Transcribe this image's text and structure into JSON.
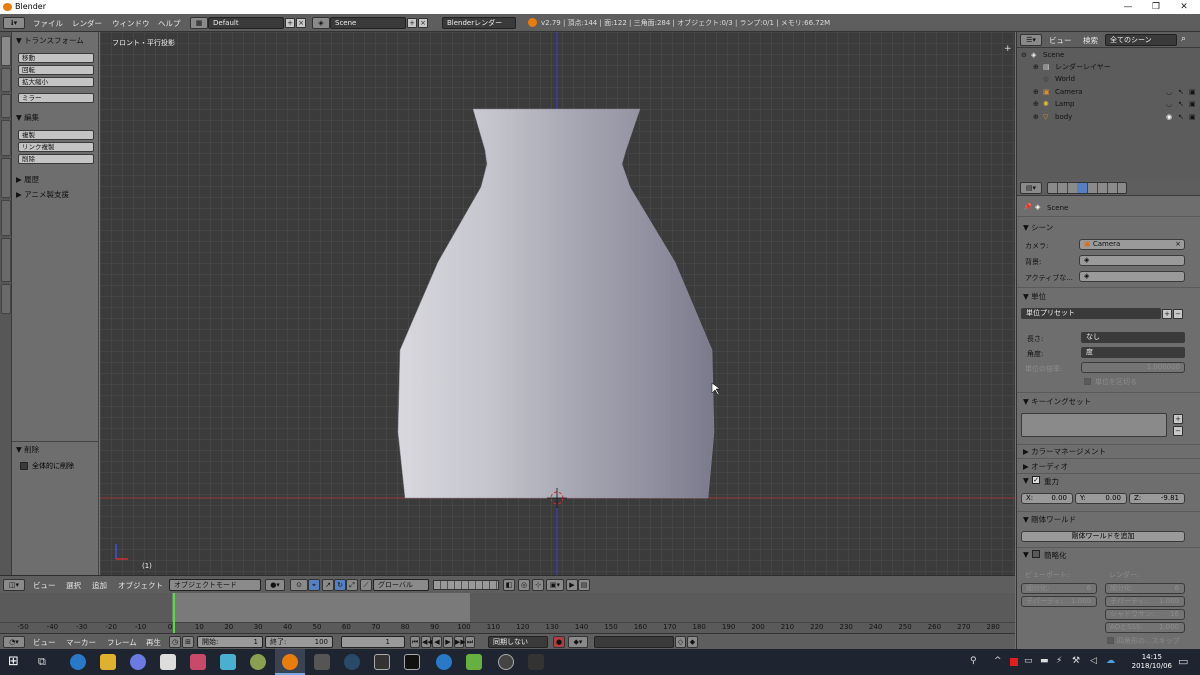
{
  "titlebar": {
    "title": "Blender",
    "minimize": "—",
    "maximize": "❐",
    "close": "✕"
  },
  "info": {
    "menus": [
      "ファイル",
      "レンダー",
      "ウィンドウ",
      "ヘルプ"
    ],
    "layout": "Default",
    "scene": "Scene",
    "engine": "Blenderレンダー",
    "stats": "v2.79 | 頂点:144 | 面:122 | 三角面:284 | オブジェクト:0/3 | ランプ:0/1 | メモリ:66.72M"
  },
  "toolshelf": {
    "transform": "▼ トランスフォーム",
    "t_buttons": [
      "移動",
      "回転",
      "拡大縮小"
    ],
    "mirror": "ミラー",
    "edit": "▼ 編集",
    "e_buttons": [
      "複製",
      "リンク複製",
      "削除"
    ],
    "history": "▶ 履歴",
    "anim": "▶ アニメ製支援",
    "op_title": "▼ 削除",
    "op_check": "全体的に削除"
  },
  "viewport": {
    "title": "フロント・平行投影",
    "frame": "(1)"
  },
  "header3d": {
    "menus": [
      "ビュー",
      "選択",
      "追加",
      "オブジェクト"
    ],
    "mode": "オブジェクトモード",
    "orientation": "グローバル"
  },
  "timeline": {
    "ticks": [
      "-50",
      "-40",
      "-30",
      "-20",
      "-10",
      "0",
      "10",
      "20",
      "30",
      "40",
      "50",
      "60",
      "70",
      "80",
      "90",
      "100",
      "110",
      "120",
      "130",
      "140",
      "150",
      "160",
      "170",
      "180",
      "190",
      "200",
      "210",
      "220",
      "230",
      "240",
      "250",
      "260",
      "270",
      "280"
    ],
    "menus": [
      "ビュー",
      "マーカー",
      "フレーム",
      "再生"
    ],
    "start": "開始:",
    "start_val": "1",
    "end": "終了:",
    "end_val": "100",
    "current": "1",
    "sync": "同期しない"
  },
  "outliner": {
    "view": "ビュー",
    "search": "検索",
    "scope": "全てのシーン",
    "rows": [
      "Scene",
      "レンダーレイヤー",
      "World",
      "Camera",
      "Lamp",
      "body"
    ]
  },
  "properties": {
    "context": "Scene",
    "scene_sect": "▼ シーン",
    "camera_lbl": "カメラ:",
    "camera_val": "Camera",
    "bg_lbl": "背景:",
    "active_lbl": "アクティブな...",
    "units_sect": "▼ 単位",
    "unit_preset": "単位プリセット",
    "length_lbl": "長さ:",
    "length_val": "なし",
    "angle_lbl": "角度:",
    "angle_val": "度",
    "scale_lbl": "単位の倍率:",
    "scale_val": "1.000000",
    "separate": "単位を区切る",
    "keying_sect": "▼ キーイングセット",
    "color_sect": "▶ カラーマネージメント",
    "audio_sect": "▶ オーディオ",
    "gravity_sect": "重力",
    "gx": "X:",
    "gx_val": "0.00",
    "gy": "Y:",
    "gy_val": "0.00",
    "gz": "Z:",
    "gz_val": "-9.81",
    "rigid_sect": "▼ 剛体ワールド",
    "rigid_btn": "剛体ワールドを追加",
    "simplify_sect": "簡略化",
    "viewport_lbl": "ビューポート:",
    "render_lbl": "レンダー:",
    "sub_lbl": "細分化:",
    "sub_val": "6",
    "sub2_val": "6",
    "child_lbl": "子パーティ:",
    "child_val": "1.000",
    "child2_val": "1.000",
    "shadow_lbl": "シャドウサン:",
    "shadow_val": "16",
    "ao_lbl": "AOとSSS:",
    "ao_val": "1.000",
    "skip": "四角形の...スキップ"
  },
  "taskbar": {
    "time": "14:15",
    "date": "2018/10/06"
  }
}
